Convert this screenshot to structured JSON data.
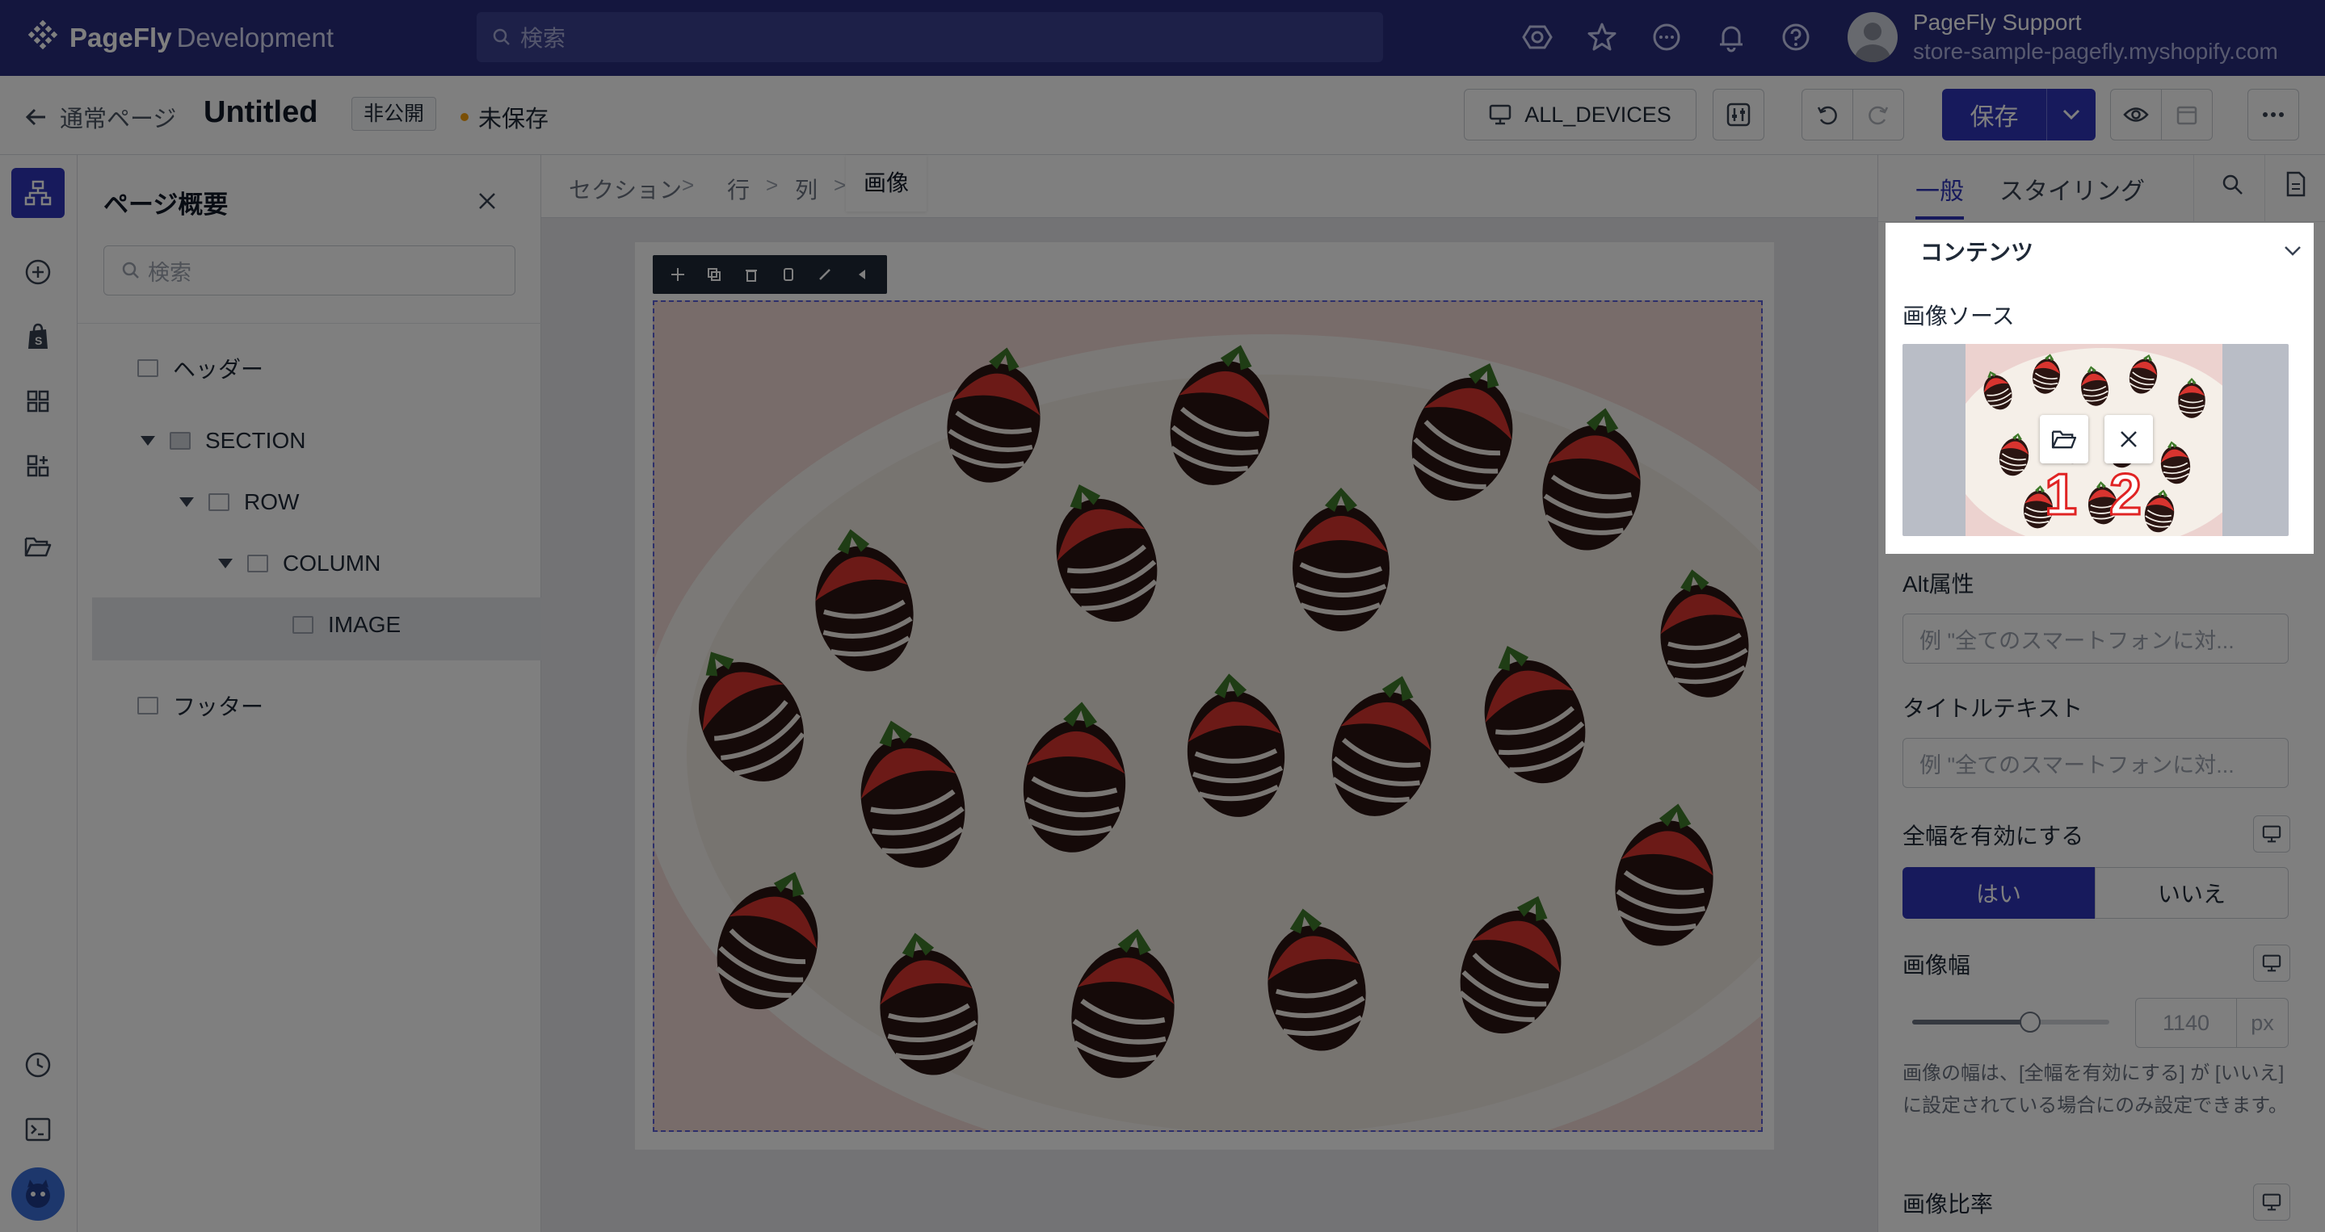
{
  "app": {
    "brand_bold": "PageFly",
    "brand_light": "Development"
  },
  "topbar": {
    "search_placeholder": "検索",
    "user_name": "PageFly Support",
    "user_store": "store-sample-pagefly.myshopify.com"
  },
  "editor": {
    "back_label": "通常ページ",
    "title": "Untitled",
    "visibility_badge": "非公開",
    "unsaved_label": "未保存",
    "devices_label": "ALL_DEVICES",
    "save_label": "保存"
  },
  "outline": {
    "title": "ページ概要",
    "search_placeholder": "検索",
    "items": [
      "ヘッダー",
      "SECTION",
      "ROW",
      "COLUMN",
      "IMAGE",
      "フッター"
    ]
  },
  "breadcrumb": [
    "セクション",
    "行",
    "列",
    "画像"
  ],
  "inspector": {
    "tabs": [
      "一般",
      "スタイリング"
    ],
    "section_title": "コンテンツ",
    "image_source_label": "画像ソース",
    "callout_1": "1",
    "callout_2": "2",
    "alt_label": "Alt属性",
    "alt_placeholder": "例 \"全てのスマートフォンに対...",
    "title_text_label": "タイトルテキスト",
    "title_text_placeholder": "例 \"全てのスマートフォンに対...",
    "full_width_label": "全幅を有効にする",
    "yes_label": "はい",
    "no_label": "いいえ",
    "image_width_label": "画像幅",
    "image_width_value": "1140",
    "image_width_unit": "px",
    "image_width_slider_fraction": 0.6,
    "image_width_help": "画像の幅は、[全幅を有効にする] が [いいえ] に設定されている場合にのみ設定できます。",
    "aspect_ratio_label": "画像比率"
  },
  "colors": {
    "brand": "#282d7c",
    "accent": "#2e35b8",
    "unsaved_dot": "#f59e0b",
    "callout": "#e02424"
  }
}
